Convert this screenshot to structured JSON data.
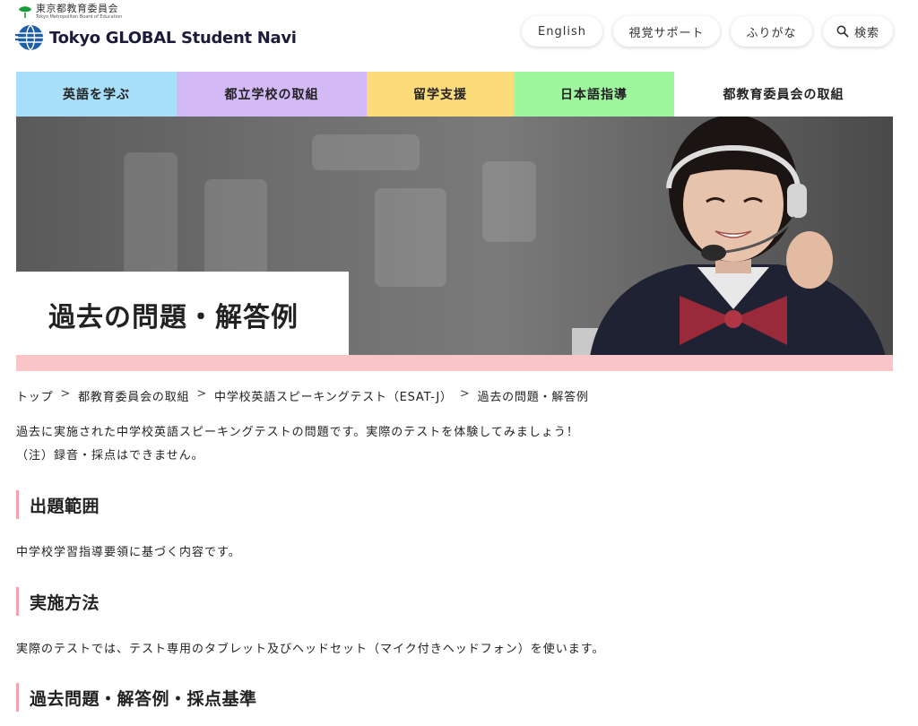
{
  "header": {
    "org_ja": "東京都教育委員会",
    "org_en": "Tokyo Metropolitan Board of Education",
    "site_name": "Tokyo GLOBAL Student Navi",
    "utility": {
      "english": "English",
      "visual_support": "視覚サポート",
      "furigana": "ふりがな",
      "search": "検索"
    }
  },
  "nav": {
    "items": [
      {
        "label": "英語を学ぶ",
        "color": "#a8e0fb"
      },
      {
        "label": "都立学校の取組",
        "color": "#d3b9f6"
      },
      {
        "label": "留学支援",
        "color": "#fcdc7a"
      },
      {
        "label": "日本語指導",
        "color": "#9ef69e"
      },
      {
        "label": "都教育委員会の取組",
        "color": "#ffffff"
      }
    ]
  },
  "hero": {
    "title": "過去の問題・解答例",
    "accent_color": "#f9c5c9"
  },
  "breadcrumb": {
    "items": [
      "トップ",
      "都教育委員会の取組",
      "中学校英語スピーキングテスト（ESAT-J）",
      "過去の問題・解答例"
    ],
    "separator": ">"
  },
  "content": {
    "intro_line1": "過去に実施された中学校英語スピーキングテストの問題です。実際のテストを体験してみましょう！",
    "intro_line2": "（注）録音・採点はできません。",
    "sections": [
      {
        "heading": "出題範囲",
        "text": "中学校学習指導要領に基づく内容です。"
      },
      {
        "heading": "実施方法",
        "text": "実際のテストでは、テスト専用のタブレット及びヘッドセット（マイク付きヘッドフォン）を使います。"
      },
      {
        "heading": "過去問題・解答例・採点基準",
        "text": ""
      }
    ]
  }
}
